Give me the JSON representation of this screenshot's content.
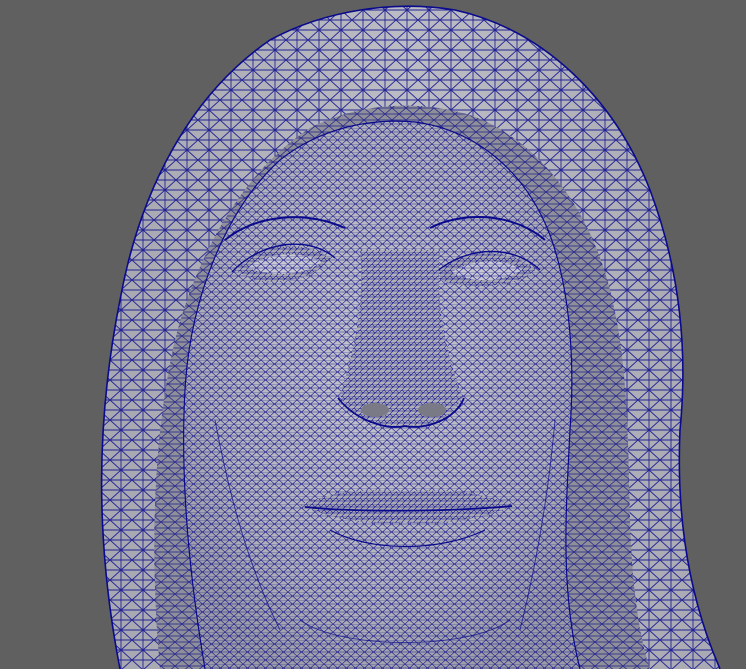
{
  "viewport": {
    "background_color": "#606060",
    "surface_color": "#b9b9c1",
    "surface_shadow_color": "#8f8f99",
    "wireframe_color": "#0a0a8c",
    "display_mode": "wireframe-on-shaded",
    "subject": "hooded-female-bust-head"
  }
}
